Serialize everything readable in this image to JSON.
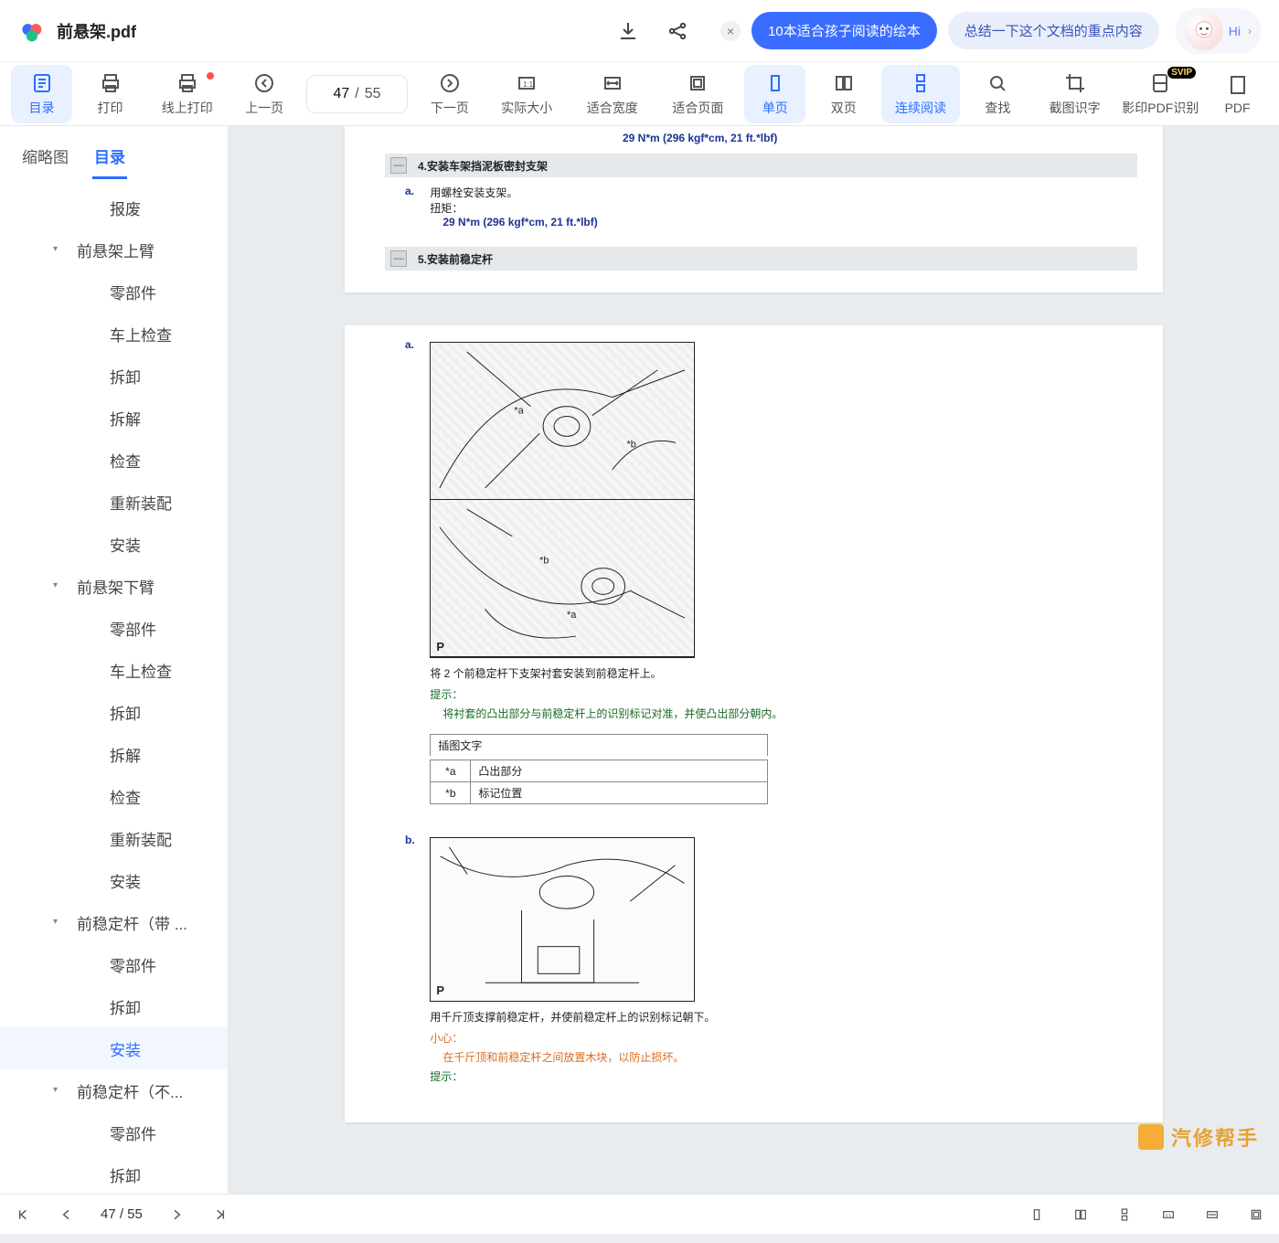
{
  "doc": {
    "title": "前悬架.pdf"
  },
  "titlebar": {
    "chip_close": "×",
    "chip1": "10本适合孩子阅读的绘本",
    "chip2": "总结一下这个文档的重点内容",
    "hi": "Hi"
  },
  "toolbar": {
    "pages": {
      "current": "47",
      "sep": "/",
      "total": "55"
    },
    "items": [
      {
        "key": "toc",
        "label": "目录"
      },
      {
        "key": "print",
        "label": "打印"
      },
      {
        "key": "print_online",
        "label": "线上打印"
      },
      {
        "key": "prev",
        "label": "上一页"
      },
      {
        "key": "next",
        "label": "下一页"
      },
      {
        "key": "actual",
        "label": "实际大小"
      },
      {
        "key": "fitw",
        "label": "适合宽度"
      },
      {
        "key": "fitp",
        "label": "适合页面"
      },
      {
        "key": "single",
        "label": "单页"
      },
      {
        "key": "double",
        "label": "双页"
      },
      {
        "key": "scroll",
        "label": "连续阅读"
      },
      {
        "key": "find",
        "label": "查找"
      },
      {
        "key": "ocrshot",
        "label": "截图识字"
      },
      {
        "key": "shadowocr",
        "label": "影印PDF识别"
      },
      {
        "key": "pdf_more",
        "label": "PDF"
      }
    ]
  },
  "sidebar": {
    "tabs": {
      "thumb": "缩略图",
      "toc": "目录"
    },
    "items": [
      {
        "label": "报废",
        "lv": 1
      },
      {
        "label": "前悬架上臂",
        "lv": 0,
        "exp": true
      },
      {
        "label": "零部件",
        "lv": 1
      },
      {
        "label": "车上检查",
        "lv": 1
      },
      {
        "label": "拆卸",
        "lv": 1
      },
      {
        "label": "拆解",
        "lv": 1
      },
      {
        "label": "检查",
        "lv": 1
      },
      {
        "label": "重新装配",
        "lv": 1
      },
      {
        "label": "安装",
        "lv": 1
      },
      {
        "label": "前悬架下臂",
        "lv": 0,
        "exp": true
      },
      {
        "label": "零部件",
        "lv": 1
      },
      {
        "label": "车上检查",
        "lv": 1
      },
      {
        "label": "拆卸",
        "lv": 1
      },
      {
        "label": "拆解",
        "lv": 1
      },
      {
        "label": "检查",
        "lv": 1
      },
      {
        "label": "重新装配",
        "lv": 1
      },
      {
        "label": "安装",
        "lv": 1
      },
      {
        "label": "前稳定杆（带 ...",
        "lv": 0,
        "exp": true
      },
      {
        "label": "零部件",
        "lv": 1
      },
      {
        "label": "拆卸",
        "lv": 1
      },
      {
        "label": "安装",
        "lv": 1,
        "selected": true
      },
      {
        "label": "前稳定杆（不...",
        "lv": 0,
        "exp": true
      },
      {
        "label": "零部件",
        "lv": 1
      },
      {
        "label": "拆卸",
        "lv": 1
      }
    ]
  },
  "page1": {
    "torque_top": "29 N*m (296 kgf*cm, 21 ft.*lbf)",
    "sec4_title": "4.安装车架挡泥板密封支架",
    "step_a_lbl": "a.",
    "step_a_text": "用螺栓安装支架。",
    "torque_label": "扭矩：",
    "torque_value": "29 N*m (296 kgf*cm, 21 ft.*lbf)",
    "sec5_title": "5.安装前稳定杆",
    "minus": "—"
  },
  "page2": {
    "step_a_lbl": "a.",
    "cap_a": "将 2 个前稳定杆下支架衬套安装到前稳定杆上。",
    "tip_lbl": "提示：",
    "tip_a": "将衬套的凸出部分与前稳定杆上的识别标记对准，并使凸出部分朝内。",
    "legend_head": "插图文字",
    "legend": {
      "a_key": "*a",
      "a_val": "凸出部分",
      "b_key": "*b",
      "b_val": "标记位置"
    },
    "step_b_lbl": "b.",
    "cap_b": "用千斤顶支撑前稳定杆，并使前稳定杆上的识别标记朝下。",
    "care_lbl": "小心：",
    "care_b": "在千斤顶和前稳定杆之间放置木块，以防止损坏。",
    "tip_lbl2": "提示：",
    "plabel": "P"
  },
  "bottombar": {
    "pages": "47  / 55"
  },
  "watermark": {
    "text": "汽修帮手"
  }
}
